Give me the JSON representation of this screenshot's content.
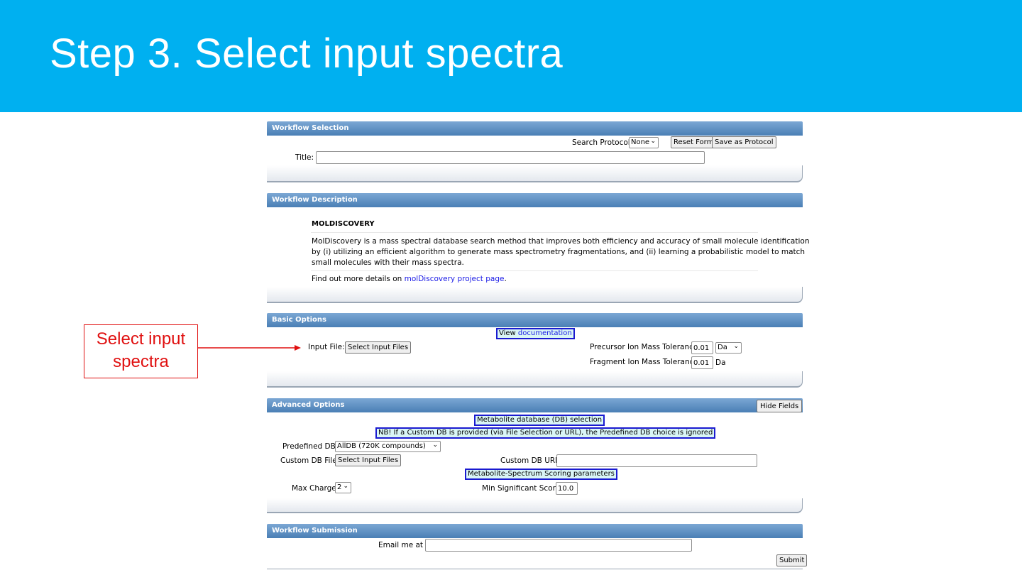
{
  "slide": {
    "title": "Step 3. Select input spectra",
    "callout": [
      "Select input",
      "spectra"
    ]
  },
  "workflow_selection": {
    "header": "Workflow Selection",
    "search_protocol_label": "Search Protocol:",
    "search_protocol_value": "None",
    "reset_label": "Reset Form",
    "save_label": "Save as Protocol",
    "title_label": "Title:",
    "title_value": ""
  },
  "workflow_description": {
    "header": "Workflow Description",
    "name": "MOLDISCOVERY",
    "lines": [
      "MolDiscovery is a mass spectral database search method that improves both efficiency and accuracy of small molecule identification",
      "by (i) utilizing an efficient algorithm to generate mass spectrometry fragmentations, and (ii) learning a probabilistic model to match",
      "small molecules with their mass spectra."
    ],
    "more_prefix": "Find out more details on ",
    "more_link": "molDiscovery project page",
    "more_suffix": "."
  },
  "basic_options": {
    "header": "Basic Options",
    "doc_prefix": "View ",
    "doc_link": "documentation",
    "input_file_label": "Input File:",
    "select_files_label": "Select Input Files",
    "precursor_label": "Precursor Ion Mass Tolerance:",
    "precursor_value": "0.01",
    "precursor_unit": "Da",
    "fragment_label": "Fragment Ion Mass Tolerance:",
    "fragment_value": "0.01",
    "fragment_unit": "Da"
  },
  "advanced_options": {
    "header": "Advanced Options",
    "hide_label": "Hide Fields",
    "db_section": "Metabolite database (DB) selection",
    "nb_note": "NB! If a Custom DB is provided (via File Selection or URL), the Predefined DB choice is ignored",
    "predefined_label": "Predefined DB:",
    "predefined_value": "AllDB (720K compounds)",
    "custom_file_label": "Custom DB File:",
    "select_files_label": "Select Input Files",
    "custom_url_label": "Custom DB URL:",
    "custom_url_value": "",
    "scoring_section": "Metabolite-Spectrum Scoring parameters",
    "max_charge_label": "Max Charge:",
    "max_charge_value": "2",
    "min_score_label": "Min Significant Score:",
    "min_score_value": "10.0"
  },
  "workflow_submission": {
    "header": "Workflow Submission",
    "email_label": "Email me at",
    "email_value": "",
    "submit_label": "Submit"
  },
  "colors": {
    "banner": "#00b0f0",
    "callout": "#e01010",
    "highlight_border": "#1a1ad0"
  }
}
